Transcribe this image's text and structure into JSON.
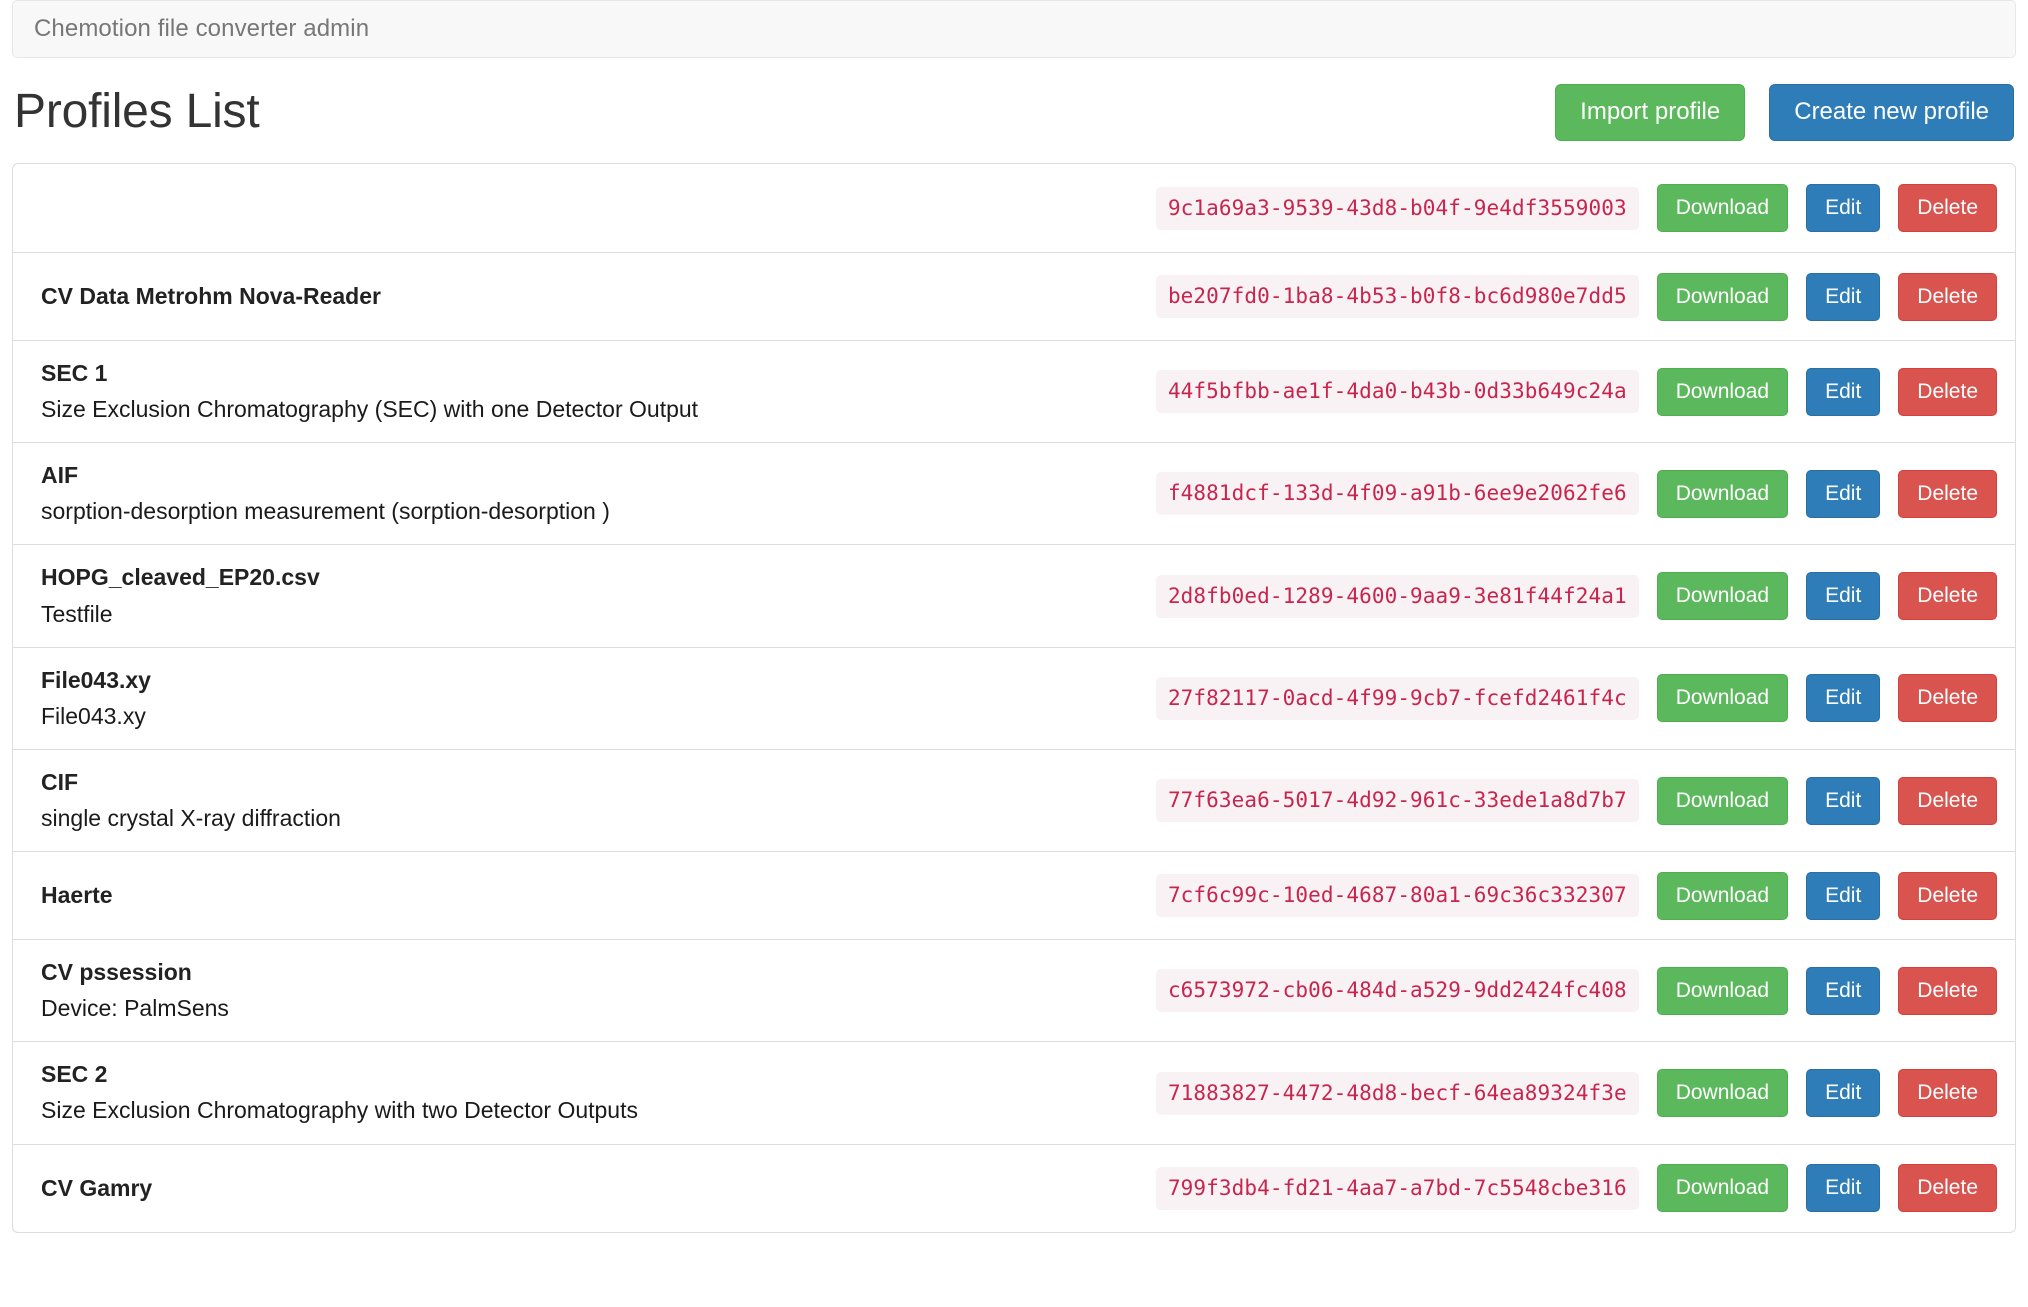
{
  "navbar": {
    "brand": "Chemotion file converter admin"
  },
  "header": {
    "title": "Profiles List",
    "import_label": "Import profile",
    "create_label": "Create new profile"
  },
  "row_actions": {
    "download_label": "Download",
    "edit_label": "Edit",
    "delete_label": "Delete"
  },
  "colors": {
    "green": "#5cb85c",
    "blue": "#2e7cb8",
    "red": "#d9534f",
    "code_text": "#c7254e",
    "code_bg": "#f9f2f4",
    "navbar_bg": "#f8f8f8",
    "navbar_text": "#777777",
    "border": "#dddddd"
  },
  "profiles": [
    {
      "title": "",
      "description": "",
      "uuid": "9c1a69a3-9539-43d8-b04f-9e4df3559003"
    },
    {
      "title": "CV Data Metrohm Nova-Reader",
      "description": "",
      "uuid": "be207fd0-1ba8-4b53-b0f8-bc6d980e7dd5"
    },
    {
      "title": "SEC 1",
      "description": "Size Exclusion Chromatography (SEC) with one Detector Output",
      "uuid": "44f5bfbb-ae1f-4da0-b43b-0d33b649c24a"
    },
    {
      "title": "AIF",
      "description": "sorption-desorption measurement (sorption-desorption )",
      "uuid": "f4881dcf-133d-4f09-a91b-6ee9e2062fe6"
    },
    {
      "title": "HOPG_cleaved_EP20.csv",
      "description": "Testfile",
      "uuid": "2d8fb0ed-1289-4600-9aa9-3e81f44f24a1"
    },
    {
      "title": "File043.xy",
      "description": "File043.xy",
      "uuid": "27f82117-0acd-4f99-9cb7-fcefd2461f4c"
    },
    {
      "title": "CIF",
      "description": "single crystal X-ray diffraction",
      "uuid": "77f63ea6-5017-4d92-961c-33ede1a8d7b7"
    },
    {
      "title": "Haerte",
      "description": "",
      "uuid": "7cf6c99c-10ed-4687-80a1-69c36c332307"
    },
    {
      "title": "CV pssession",
      "description": "Device: PalmSens",
      "uuid": "c6573972-cb06-484d-a529-9dd2424fc408"
    },
    {
      "title": "SEC 2",
      "description": "Size Exclusion Chromatography with two Detector Outputs",
      "uuid": "71883827-4472-48d8-becf-64ea89324f3e"
    },
    {
      "title": "CV Gamry",
      "description": "",
      "uuid": "799f3db4-fd21-4aa7-a7bd-7c5548cbe316"
    }
  ]
}
